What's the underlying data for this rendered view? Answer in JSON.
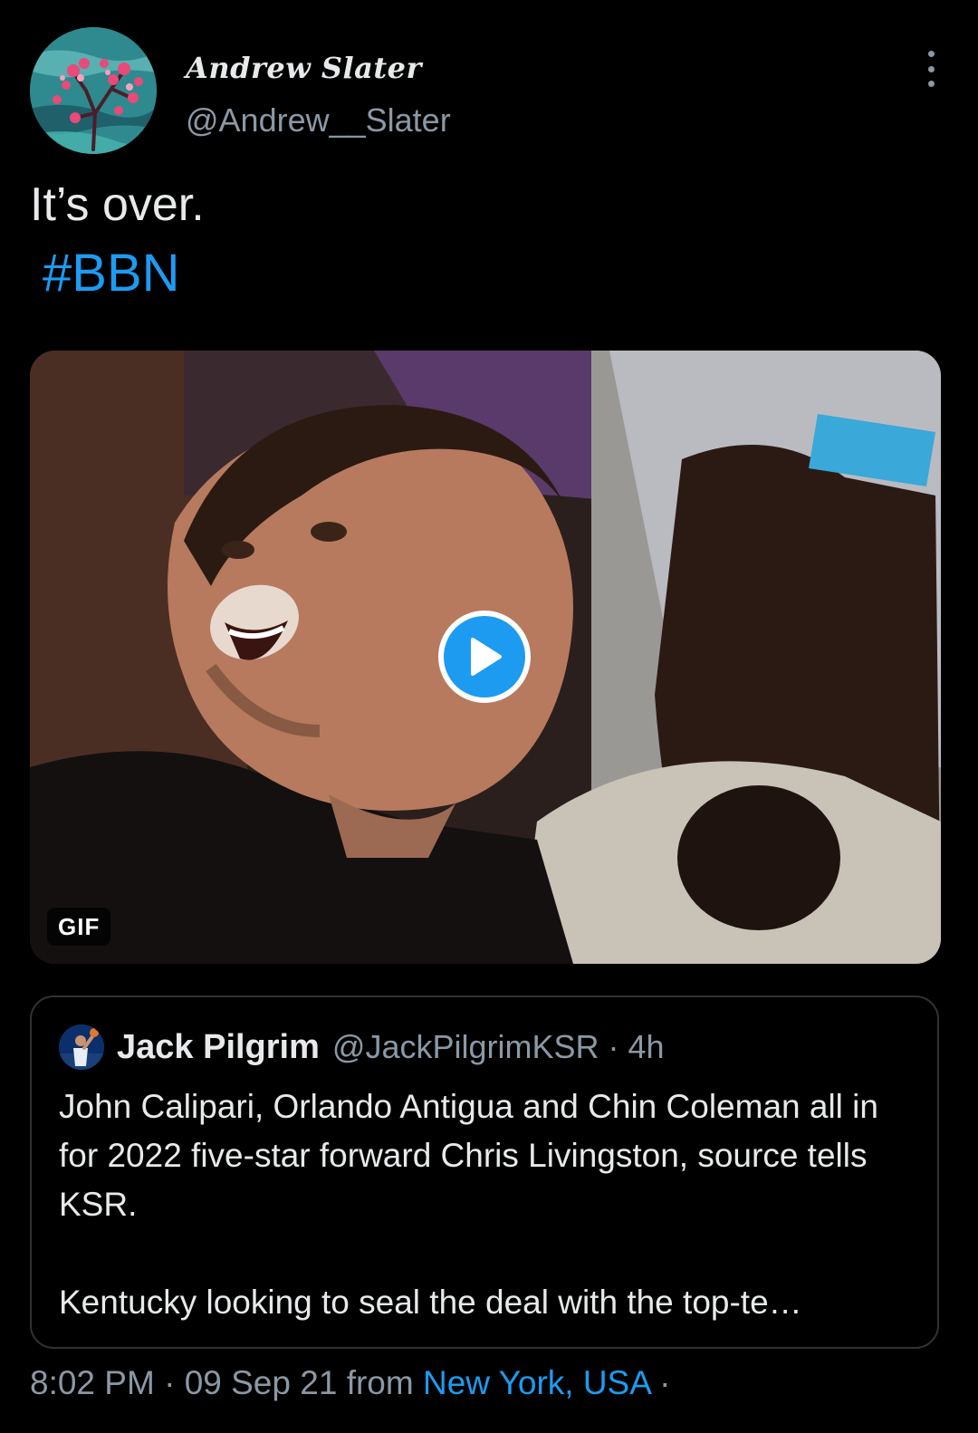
{
  "author": {
    "display_name": "Andrew Slater",
    "handle": "@Andrew__Slater",
    "avatar_icon": "cherry-blossom-painting-avatar"
  },
  "tweet": {
    "text": "It’s over.",
    "hashtag": "#BBN"
  },
  "media": {
    "badge": "GIF",
    "play_icon": "play-icon"
  },
  "quoted_tweet": {
    "name": "Jack Pilgrim",
    "handle": "@JackPilgrimKSR",
    "separator": "·",
    "time": "4h",
    "paragraph1": "John Calipari, Orlando Antigua and Chin Coleman all in for 2022 five-star forward Chris Livingston, source tells KSR.",
    "paragraph2": "Kentucky looking to seal the deal with the top-te…"
  },
  "meta": {
    "time": "8:02 PM",
    "sep1": "·",
    "date": "09 Sep 21",
    "from": "from",
    "location": "New York, USA",
    "sep2": "·"
  },
  "colors": {
    "accent": "#1d9bf0",
    "background": "#000000",
    "text": "#e7e9ea",
    "muted": "#8b98a5"
  }
}
